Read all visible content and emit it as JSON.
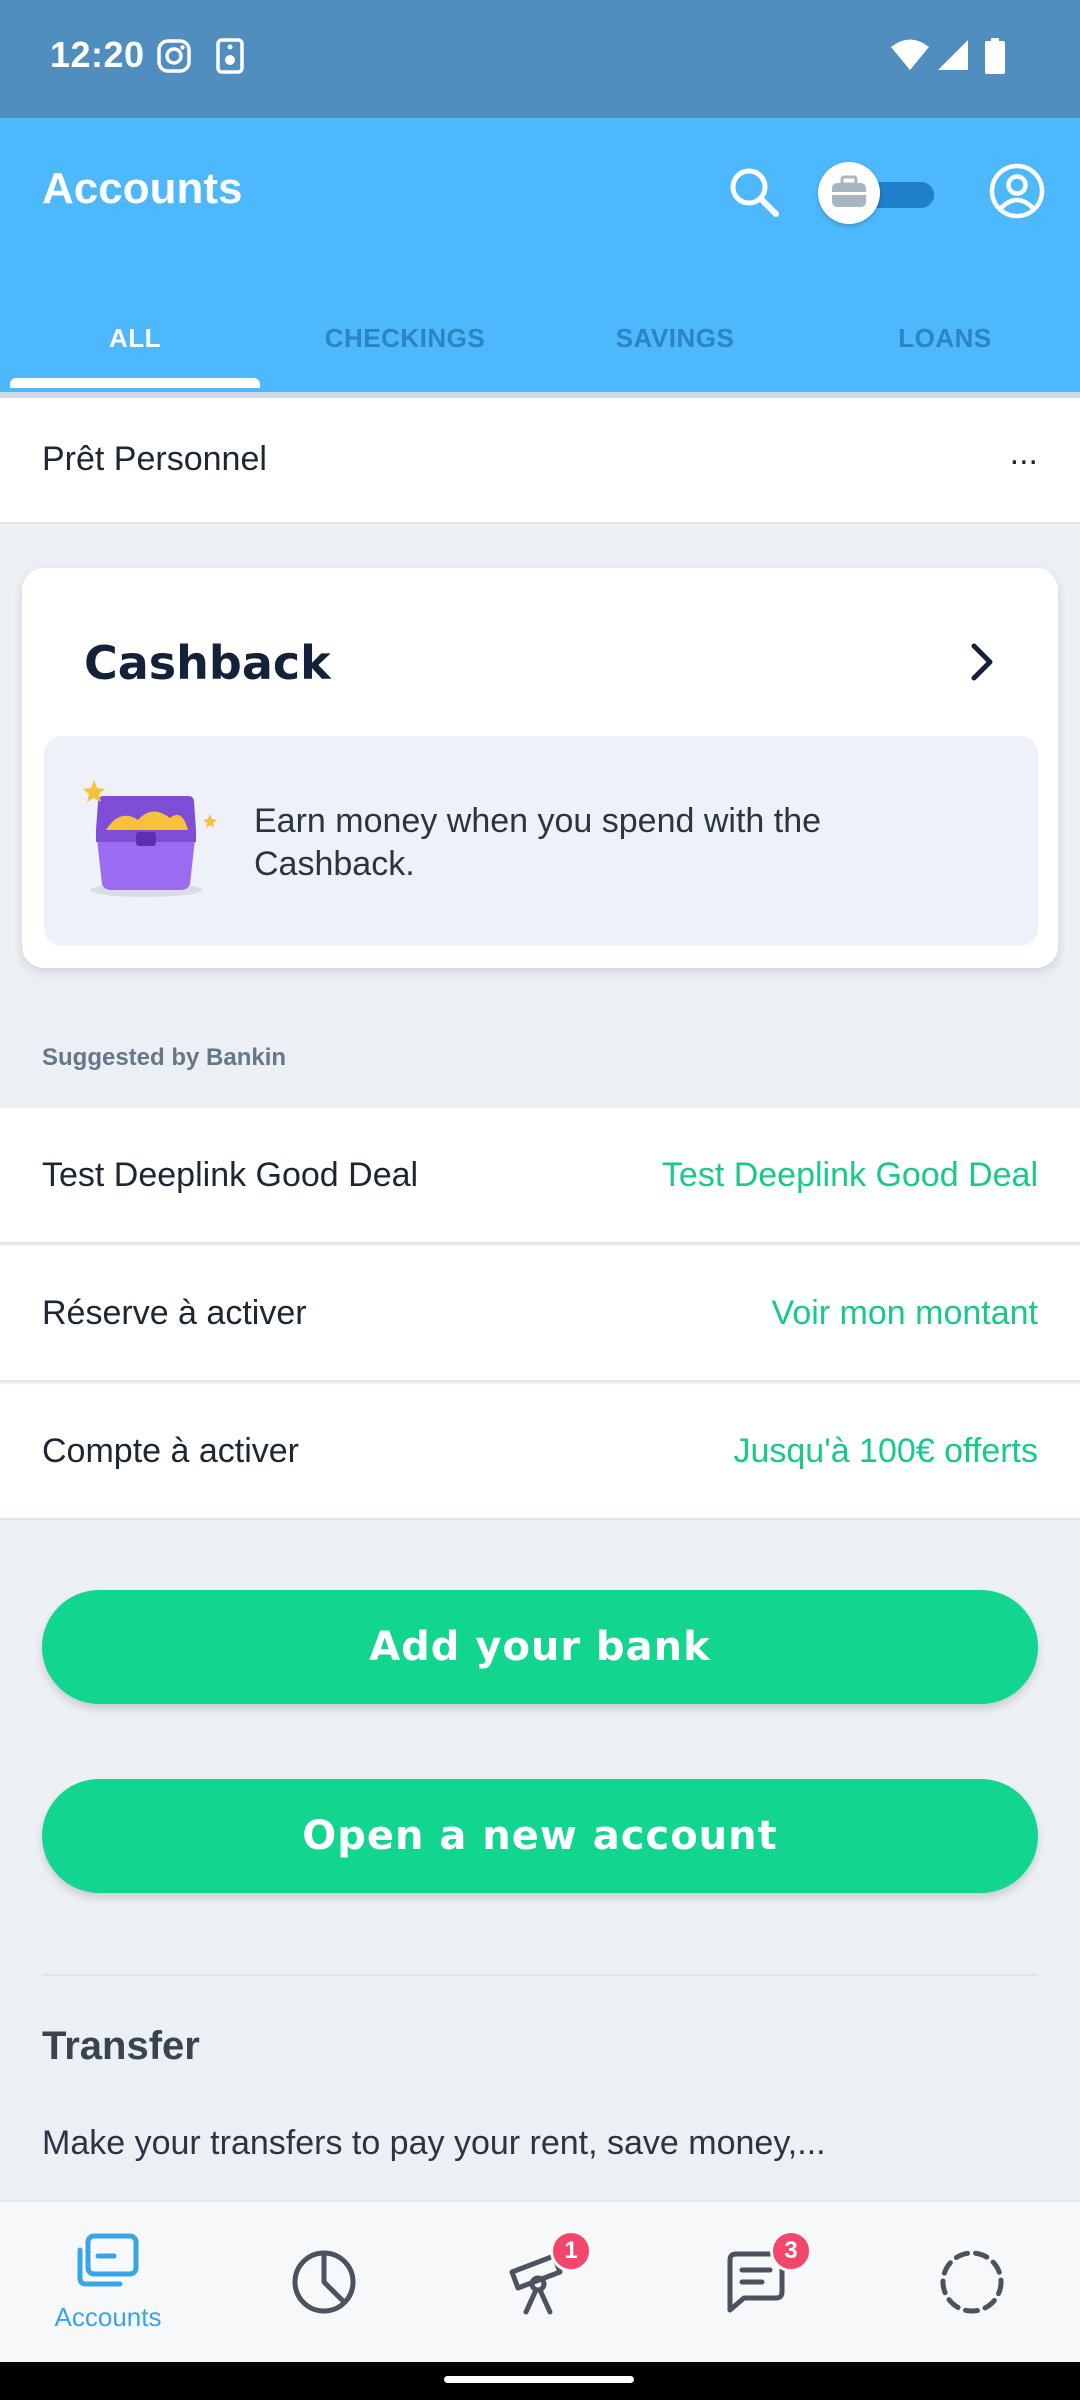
{
  "status_bar": {
    "time": "12:20",
    "icons": [
      "instagram-icon",
      "speaker-icon",
      "wifi-icon",
      "signal-icon",
      "battery-icon"
    ]
  },
  "header": {
    "title": "Accounts",
    "tabs": [
      {
        "label": "ALL",
        "active": true
      },
      {
        "label": "CHECKINGS",
        "active": false
      },
      {
        "label": "SAVINGS",
        "active": false
      },
      {
        "label": "LOANS",
        "active": false
      }
    ]
  },
  "loan_row": {
    "label": "Prêt Personnel",
    "more": "..."
  },
  "cashback": {
    "title": "Cashback",
    "description": "Earn money when you spend with the Cashback."
  },
  "suggested": {
    "caption": "Suggested by Bankin",
    "items": [
      {
        "label": "Test Deeplink Good Deal",
        "action": "Test Deeplink Good Deal"
      },
      {
        "label": "Réserve à activer",
        "action": "Voir mon montant"
      },
      {
        "label": "Compte à activer",
        "action": "Jusqu'à 100€ offerts"
      }
    ]
  },
  "actions": {
    "add_bank": "Add your bank",
    "open_account": "Open a new account"
  },
  "transfer": {
    "title": "Transfer",
    "description": "Make your transfers to pay your rent, save money,..."
  },
  "bottom_nav": {
    "items": [
      {
        "label": "Accounts",
        "icon": "accounts-icon",
        "active": true
      },
      {
        "label": "",
        "icon": "analysis-pie-icon",
        "badge": ""
      },
      {
        "label": "",
        "icon": "telescope-icon",
        "badge": "1"
      },
      {
        "label": "",
        "icon": "messages-icon",
        "badge": "3"
      },
      {
        "label": "",
        "icon": "loading-circle-icon",
        "badge": ""
      }
    ]
  },
  "colors": {
    "status_bar": "#4f8ebf",
    "header": "#4db8fb",
    "accent_green": "#12d690",
    "link_green": "#18c98a",
    "badge": "#f2466a",
    "nav_active": "#3aa4e8"
  }
}
